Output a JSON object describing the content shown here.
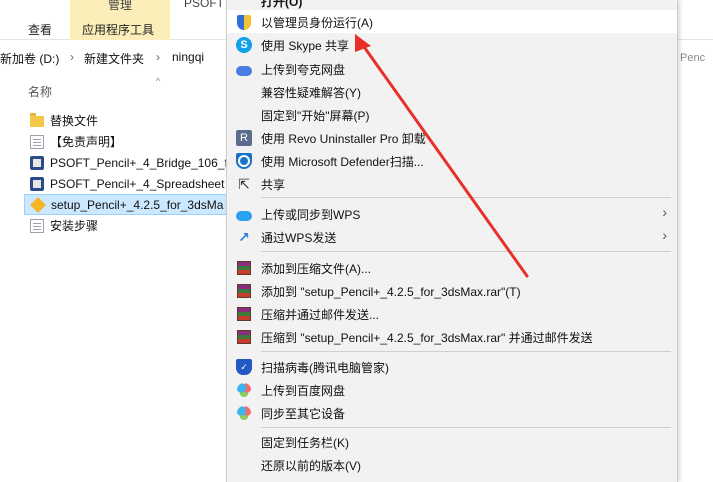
{
  "ribbon": {
    "context_group": "管理",
    "context_app": "PSOFT",
    "tabs": [
      "查看",
      "应用程序工具"
    ]
  },
  "address": {
    "segments": [
      "新加卷 (D:)",
      "新建文件夹",
      "ningqi"
    ],
    "right_partial": "Penc"
  },
  "list": {
    "column_name": "名称",
    "sort_arrow": "^",
    "files": [
      {
        "name": "替换文件",
        "icon": "folder-icon"
      },
      {
        "name": "【免责声明】",
        "icon": "document-icon"
      },
      {
        "name": "PSOFT_Pencil+_4_Bridge_106_f",
        "icon": "installer-icon"
      },
      {
        "name": "PSOFT_Pencil+_4_Spreadsheet",
        "icon": "installer-icon"
      },
      {
        "name": "setup_Pencil+_4.2.5_for_3dsMa",
        "icon": "setup-icon"
      },
      {
        "name": "安装步骤",
        "icon": "document-icon"
      }
    ]
  },
  "menu": {
    "top_partial": "打开(O)",
    "items": [
      {
        "label": "以管理员身份运行(A)",
        "icon": "uac-shield-icon"
      },
      {
        "label": "使用 Skype 共享",
        "icon": "skype-icon"
      },
      {
        "label": "上传到夸克网盘",
        "icon": "quark-cloud-icon"
      },
      {
        "label": "兼容性疑难解答(Y)",
        "icon": ""
      },
      {
        "label": "固定到\"开始\"屏幕(P)",
        "icon": ""
      },
      {
        "label": "使用 Revo Uninstaller Pro 卸载",
        "icon": "revo-icon"
      },
      {
        "label": "使用 Microsoft Defender扫描...",
        "icon": "defender-icon"
      },
      {
        "label": "共享",
        "icon": "share-icon"
      },
      {
        "label": "上传或同步到WPS",
        "icon": "wps-cloud-icon",
        "submenu": "›"
      },
      {
        "label": "通过WPS发送",
        "icon": "wps-send-icon",
        "submenu": "›"
      },
      {
        "label": "添加到压缩文件(A)...",
        "icon": "winrar-icon"
      },
      {
        "label": "添加到 \"setup_Pencil+_4.2.5_for_3dsMax.rar\"(T)",
        "icon": "winrar-icon"
      },
      {
        "label": "压缩并通过邮件发送...",
        "icon": "winrar-icon"
      },
      {
        "label": "压缩到 \"setup_Pencil+_4.2.5_for_3dsMax.rar\" 并通过邮件发送",
        "icon": "winrar-icon"
      },
      {
        "label": "扫描病毒(腾讯电脑管家)",
        "icon": "tencent-shield-icon"
      },
      {
        "label": "上传到百度网盘",
        "icon": "baidu-cloud-icon"
      },
      {
        "label": "同步至其它设备",
        "icon": "baidu-cloud-icon"
      },
      {
        "label": "固定到任务栏(K)",
        "icon": ""
      },
      {
        "label": "还原以前的版本(V)",
        "icon": ""
      }
    ]
  },
  "colors": {
    "menu_bg": "#f2f2f2",
    "selection": "#cce8ff",
    "arrow": "#e8302a",
    "ribbon_context": "#fbeeb8"
  }
}
